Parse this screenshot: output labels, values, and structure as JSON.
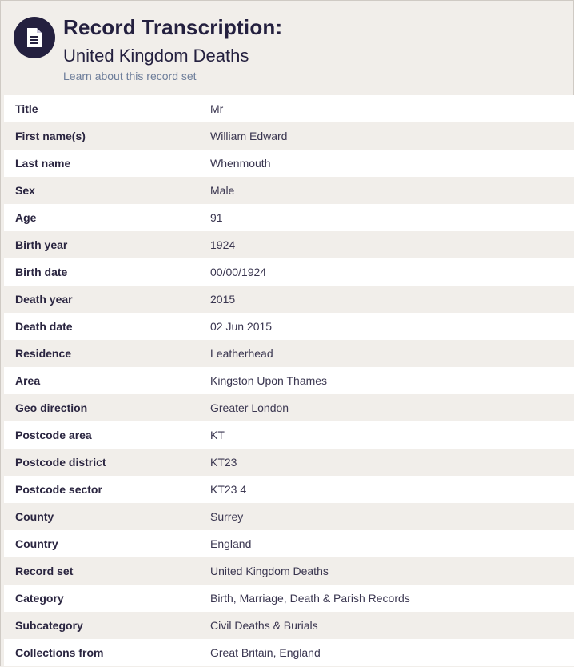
{
  "header": {
    "title": "Record Transcription:",
    "subtitle": "United Kingdom Deaths",
    "learn_link": "Learn about this record set",
    "icon": "document-icon"
  },
  "colors": {
    "accent": "#24203f",
    "link": "#6d7d9a",
    "row_alt": "#f1eeea"
  },
  "rows": [
    {
      "label": "Title",
      "value": "Mr"
    },
    {
      "label": "First name(s)",
      "value": "William Edward"
    },
    {
      "label": "Last name",
      "value": "Whenmouth"
    },
    {
      "label": "Sex",
      "value": "Male"
    },
    {
      "label": "Age",
      "value": "91"
    },
    {
      "label": "Birth year",
      "value": "1924"
    },
    {
      "label": "Birth date",
      "value": "00/00/1924"
    },
    {
      "label": "Death year",
      "value": "2015"
    },
    {
      "label": "Death date",
      "value": "02 Jun 2015"
    },
    {
      "label": "Residence",
      "value": "Leatherhead"
    },
    {
      "label": "Area",
      "value": "Kingston Upon Thames"
    },
    {
      "label": "Geo direction",
      "value": "Greater London"
    },
    {
      "label": "Postcode area",
      "value": "KT"
    },
    {
      "label": "Postcode district",
      "value": "KT23"
    },
    {
      "label": "Postcode sector",
      "value": "KT23 4"
    },
    {
      "label": "County",
      "value": "Surrey"
    },
    {
      "label": "Country",
      "value": "England"
    },
    {
      "label": "Record set",
      "value": "United Kingdom Deaths"
    },
    {
      "label": "Category",
      "value": "Birth, Marriage, Death & Parish Records"
    },
    {
      "label": "Subcategory",
      "value": "Civil Deaths & Burials"
    },
    {
      "label": "Collections from",
      "value": "Great Britain, England"
    }
  ]
}
